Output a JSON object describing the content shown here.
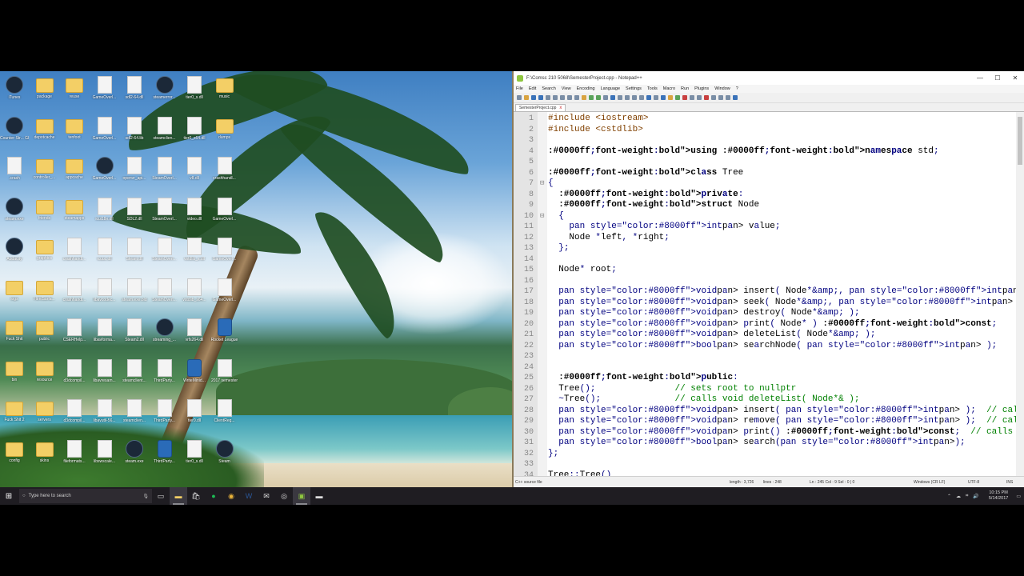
{
  "desktop": {
    "icons": [
      {
        "label": "iTunes",
        "type": "app",
        "col": 0,
        "row": 0
      },
      {
        "label": "package",
        "type": "folder",
        "col": 1,
        "row": 0
      },
      {
        "label": "reuse",
        "type": "folder",
        "col": 2,
        "row": 0
      },
      {
        "label": "GameOverl...",
        "type": "file",
        "col": 3,
        "row": 0
      },
      {
        "label": "sdl2-64.dll",
        "type": "file",
        "col": 4,
        "row": 0
      },
      {
        "label": "steamerror...",
        "type": "app",
        "col": 5,
        "row": 0
      },
      {
        "label": "tier0_s.dll",
        "type": "file",
        "col": 6,
        "row": 0
      },
      {
        "label": "music",
        "type": "folder",
        "col": 7,
        "row": 0
      },
      {
        "label": "Counter-Str... Global Offe...",
        "type": "app",
        "col": 0,
        "row": 1
      },
      {
        "label": "depotcache",
        "type": "folder",
        "col": 1,
        "row": 1
      },
      {
        "label": "tenfoot",
        "type": "folder",
        "col": 2,
        "row": 1
      },
      {
        "label": "GameOverl...",
        "type": "file",
        "col": 3,
        "row": 1
      },
      {
        "label": "sdl2-64.lib",
        "type": "file",
        "col": 4,
        "row": 1
      },
      {
        "label": "steamclien...",
        "type": "file",
        "col": 5,
        "row": 1
      },
      {
        "label": "tier0_s64.dll",
        "type": "file",
        "col": 6,
        "row": 1
      },
      {
        "label": "dumps",
        "type": "folder",
        "col": 7,
        "row": 1
      },
      {
        "label": ".crash",
        "type": "file",
        "col": 0,
        "row": 2
      },
      {
        "label": "controller_...",
        "type": "folder",
        "col": 1,
        "row": 2
      },
      {
        "label": "appcache",
        "type": "folder",
        "col": 2,
        "row": 2
      },
      {
        "label": "GameOverl...",
        "type": "app",
        "col": 3,
        "row": 2
      },
      {
        "label": "openvr_api...",
        "type": "file",
        "col": 4,
        "row": 2
      },
      {
        "label": "SteamOverl...",
        "type": "file",
        "col": 5,
        "row": 2
      },
      {
        "label": "v8.dll",
        "type": "file",
        "col": 6,
        "row": 2
      },
      {
        "label": "crashhandl...",
        "type": "file",
        "col": 7,
        "row": 2
      },
      {
        "label": "steam.exe",
        "type": "app",
        "col": 0,
        "row": 3
      },
      {
        "label": "friends",
        "type": "folder",
        "col": 1,
        "row": 3
      },
      {
        "label": "steamapps",
        "type": "folder",
        "col": 2,
        "row": 3
      },
      {
        "label": "icui18n.dll",
        "type": "file",
        "col": 3,
        "row": 3
      },
      {
        "label": "SDL2.dll",
        "type": "file",
        "col": 4,
        "row": 3
      },
      {
        "label": "SteamOverl...",
        "type": "file",
        "col": 5,
        "row": 3
      },
      {
        "label": "video.dll",
        "type": "file",
        "col": 6,
        "row": 3
      },
      {
        "label": "GameOverl...",
        "type": "file",
        "col": 7,
        "row": 3
      },
      {
        "label": "Audacity",
        "type": "app",
        "col": 0,
        "row": 4
      },
      {
        "label": "graphics",
        "type": "folder",
        "col": 1,
        "row": 4
      },
      {
        "label": "crashhandl...",
        "type": "file",
        "col": 2,
        "row": 4
      },
      {
        "label": "icuuc.dll",
        "type": "file",
        "col": 3,
        "row": 4
      },
      {
        "label": "Steam.dll",
        "type": "file",
        "col": 4,
        "row": 4
      },
      {
        "label": "SteamOverl...",
        "type": "file",
        "col": 5,
        "row": 4
      },
      {
        "label": "vstdlib_s.dll",
        "type": "file",
        "col": 6,
        "row": 4
      },
      {
        "label": "GameOverl...",
        "type": "file",
        "col": 7,
        "row": 4
      },
      {
        "label": "logs",
        "type": "folder",
        "col": 0,
        "row": 5
      },
      {
        "label": "HtmlSurfa...",
        "type": "folder",
        "col": 1,
        "row": 5
      },
      {
        "label": "crashhandl...",
        "type": "file",
        "col": 2,
        "row": 5
      },
      {
        "label": "libavcodec...",
        "type": "file",
        "col": 3,
        "row": 5
      },
      {
        "label": "steam.exe.old",
        "type": "file",
        "col": 4,
        "row": 5
      },
      {
        "label": "SteamOverl...",
        "type": "file",
        "col": 5,
        "row": 5
      },
      {
        "label": "vstdlib_s64...",
        "type": "file",
        "col": 6,
        "row": 5
      },
      {
        "label": "GameOverl...",
        "type": "file",
        "col": 7,
        "row": 5
      },
      {
        "label": "Fuck Shit",
        "type": "folder",
        "col": 0,
        "row": 6
      },
      {
        "label": "public",
        "type": "folder",
        "col": 1,
        "row": 6
      },
      {
        "label": "CSERHelp...",
        "type": "file",
        "col": 2,
        "row": 6
      },
      {
        "label": "libavforma...",
        "type": "file",
        "col": 3,
        "row": 6
      },
      {
        "label": "Steam2.dll",
        "type": "file",
        "col": 4,
        "row": 6
      },
      {
        "label": "streaming_...",
        "type": "app",
        "col": 5,
        "row": 6
      },
      {
        "label": "vrfs264.dll",
        "type": "file",
        "col": 6,
        "row": 6
      },
      {
        "label": "Rocket League",
        "type": "blue",
        "col": 7,
        "row": 6
      },
      {
        "label": "bin",
        "type": "folder",
        "col": 0,
        "row": 7
      },
      {
        "label": "resource",
        "type": "folder",
        "col": 1,
        "row": 7
      },
      {
        "label": "d3dcompil...",
        "type": "file",
        "col": 2,
        "row": 7
      },
      {
        "label": "libavresam...",
        "type": "file",
        "col": 3,
        "row": 7
      },
      {
        "label": "steamclient...",
        "type": "file",
        "col": 4,
        "row": 7
      },
      {
        "label": "ThirdParty...",
        "type": "file",
        "col": 5,
        "row": 7
      },
      {
        "label": "WriteMinid...",
        "type": "blue",
        "col": 6,
        "row": 7
      },
      {
        "label": "2017 semester",
        "type": "file",
        "col": 7,
        "row": 7
      },
      {
        "label": "Fuck Shit 2",
        "type": "folder",
        "col": 0,
        "row": 8
      },
      {
        "label": "servers",
        "type": "folder",
        "col": 1,
        "row": 8
      },
      {
        "label": "d3dcompil...",
        "type": "file",
        "col": 2,
        "row": 8
      },
      {
        "label": "libavutil-56...",
        "type": "file",
        "col": 3,
        "row": 8
      },
      {
        "label": "steamclien...",
        "type": "file",
        "col": 4,
        "row": 8
      },
      {
        "label": "ThirdParty...",
        "type": "file",
        "col": 5,
        "row": 8
      },
      {
        "label": "tier0.dll",
        "type": "file",
        "col": 6,
        "row": 8
      },
      {
        "label": "ClientReg...",
        "type": "file",
        "col": 7,
        "row": 8
      },
      {
        "label": "config",
        "type": "folder",
        "col": 0,
        "row": 9
      },
      {
        "label": "skins",
        "type": "folder",
        "col": 1,
        "row": 9
      },
      {
        "label": "fileformats...",
        "type": "file",
        "col": 2,
        "row": 9
      },
      {
        "label": "libswscale...",
        "type": "file",
        "col": 3,
        "row": 9
      },
      {
        "label": "steam.exe",
        "type": "app",
        "col": 4,
        "row": 9
      },
      {
        "label": "ThirdParty...",
        "type": "blue",
        "col": 5,
        "row": 9
      },
      {
        "label": "tier0_s.dll",
        "type": "file",
        "col": 6,
        "row": 9
      },
      {
        "label": "Steam",
        "type": "app",
        "col": 7,
        "row": 9
      }
    ]
  },
  "npp": {
    "title": "F:\\Comsc 210 5068\\SemesterProject.cpp - Notepad++",
    "window_buttons": {
      "minimize": "—",
      "maximize": "☐",
      "close": "✕"
    },
    "menu": [
      "File",
      "Edit",
      "Search",
      "View",
      "Encoding",
      "Language",
      "Settings",
      "Tools",
      "Macro",
      "Run",
      "Plugins",
      "Window",
      "?"
    ],
    "tab": {
      "label": "SemesterProject.cpp",
      "close": "x"
    },
    "lines": [
      {
        "n": "1",
        "fold": "",
        "code": "#include <iostream>"
      },
      {
        "n": "2",
        "fold": "",
        "code": "#include <cstdlib>"
      },
      {
        "n": "3",
        "fold": "",
        "code": ""
      },
      {
        "n": "4",
        "fold": "",
        "code": "using namespace std;"
      },
      {
        "n": "5",
        "fold": "",
        "code": ""
      },
      {
        "n": "6",
        "fold": "",
        "code": "class Tree"
      },
      {
        "n": "7",
        "fold": "⊟",
        "code": "{"
      },
      {
        "n": "8",
        "fold": "",
        "code": "  private:"
      },
      {
        "n": "9",
        "fold": "",
        "code": "  struct Node"
      },
      {
        "n": "10",
        "fold": "⊟",
        "code": "  {"
      },
      {
        "n": "11",
        "fold": "",
        "code": "    int value;"
      },
      {
        "n": "12",
        "fold": "",
        "code": "    Node *left, *right;"
      },
      {
        "n": "13",
        "fold": "",
        "code": "  };"
      },
      {
        "n": "14",
        "fold": "",
        "code": ""
      },
      {
        "n": "15",
        "fold": "",
        "code": "  Node* root;"
      },
      {
        "n": "16",
        "fold": "",
        "code": ""
      },
      {
        "n": "17",
        "fold": "",
        "code": "  void insert( Node*&, int );"
      },
      {
        "n": "18",
        "fold": "",
        "code": "  void seek( Node*&, int );  // calls void destroy( Node*& );"
      },
      {
        "n": "19",
        "fold": "",
        "code": "  void destroy( Node*& );"
      },
      {
        "n": "20",
        "fold": "",
        "code": "  void print( Node* ) const;"
      },
      {
        "n": "21",
        "fold": "",
        "code": "  void deleteList( Node*& );"
      },
      {
        "n": "22",
        "fold": "",
        "code": "  bool searchNode( int );"
      },
      {
        "n": "23",
        "fold": "",
        "code": ""
      },
      {
        "n": "24",
        "fold": "",
        "code": ""
      },
      {
        "n": "25",
        "fold": "",
        "code": "  public:"
      },
      {
        "n": "26",
        "fold": "",
        "code": "  Tree();               // sets root to nullptr"
      },
      {
        "n": "27",
        "fold": "",
        "code": "  ~Tree();              // calls void deleteList( Node*& );"
      },
      {
        "n": "28",
        "fold": "",
        "code": "  void insert( int );  // calls void insert( Node*&, int );"
      },
      {
        "n": "29",
        "fold": "",
        "code": "  void remove( int );  // calls void seek( Node*&, int );"
      },
      {
        "n": "30",
        "fold": "",
        "code": "  void print() const;  // calls void print( Node* ) const;"
      },
      {
        "n": "31",
        "fold": "",
        "code": "  bool search(int);"
      },
      {
        "n": "32",
        "fold": "",
        "code": "};"
      },
      {
        "n": "33",
        "fold": "",
        "code": ""
      },
      {
        "n": "34",
        "fold": "",
        "code": "Tree::Tree()"
      }
    ],
    "status": {
      "filetype": "C++ source file",
      "length": "length : 3,726",
      "lines": "lines : 248",
      "position": "Ln : 245   Col : 9   Sel : 0 | 0",
      "eol": "Windows (CR LF)",
      "encoding": "UTF-8",
      "mode": "INS"
    }
  },
  "taskbar": {
    "start_icon": "windows-logo-icon",
    "search_placeholder": "Type here to search",
    "time": "10:15 PM",
    "date": "5/14/2017"
  },
  "colors": {
    "keyword": "#0000ff",
    "comment": "#008000",
    "preprocessor": "#804000",
    "type": "#8000ff",
    "operator": "#000080"
  }
}
